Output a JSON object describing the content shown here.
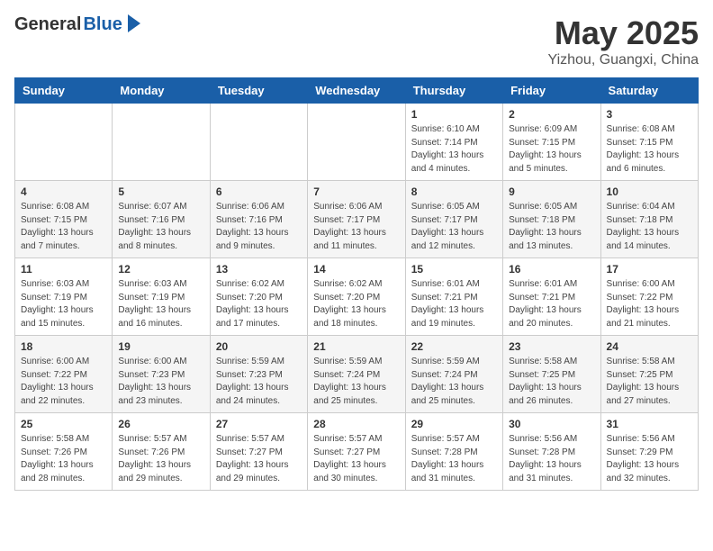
{
  "header": {
    "logo_general": "General",
    "logo_blue": "Blue",
    "month": "May 2025",
    "location": "Yizhou, Guangxi, China"
  },
  "weekdays": [
    "Sunday",
    "Monday",
    "Tuesday",
    "Wednesday",
    "Thursday",
    "Friday",
    "Saturday"
  ],
  "weeks": [
    [
      {
        "day": "",
        "info": ""
      },
      {
        "day": "",
        "info": ""
      },
      {
        "day": "",
        "info": ""
      },
      {
        "day": "",
        "info": ""
      },
      {
        "day": "1",
        "info": "Sunrise: 6:10 AM\nSunset: 7:14 PM\nDaylight: 13 hours\nand 4 minutes."
      },
      {
        "day": "2",
        "info": "Sunrise: 6:09 AM\nSunset: 7:15 PM\nDaylight: 13 hours\nand 5 minutes."
      },
      {
        "day": "3",
        "info": "Sunrise: 6:08 AM\nSunset: 7:15 PM\nDaylight: 13 hours\nand 6 minutes."
      }
    ],
    [
      {
        "day": "4",
        "info": "Sunrise: 6:08 AM\nSunset: 7:15 PM\nDaylight: 13 hours\nand 7 minutes."
      },
      {
        "day": "5",
        "info": "Sunrise: 6:07 AM\nSunset: 7:16 PM\nDaylight: 13 hours\nand 8 minutes."
      },
      {
        "day": "6",
        "info": "Sunrise: 6:06 AM\nSunset: 7:16 PM\nDaylight: 13 hours\nand 9 minutes."
      },
      {
        "day": "7",
        "info": "Sunrise: 6:06 AM\nSunset: 7:17 PM\nDaylight: 13 hours\nand 11 minutes."
      },
      {
        "day": "8",
        "info": "Sunrise: 6:05 AM\nSunset: 7:17 PM\nDaylight: 13 hours\nand 12 minutes."
      },
      {
        "day": "9",
        "info": "Sunrise: 6:05 AM\nSunset: 7:18 PM\nDaylight: 13 hours\nand 13 minutes."
      },
      {
        "day": "10",
        "info": "Sunrise: 6:04 AM\nSunset: 7:18 PM\nDaylight: 13 hours\nand 14 minutes."
      }
    ],
    [
      {
        "day": "11",
        "info": "Sunrise: 6:03 AM\nSunset: 7:19 PM\nDaylight: 13 hours\nand 15 minutes."
      },
      {
        "day": "12",
        "info": "Sunrise: 6:03 AM\nSunset: 7:19 PM\nDaylight: 13 hours\nand 16 minutes."
      },
      {
        "day": "13",
        "info": "Sunrise: 6:02 AM\nSunset: 7:20 PM\nDaylight: 13 hours\nand 17 minutes."
      },
      {
        "day": "14",
        "info": "Sunrise: 6:02 AM\nSunset: 7:20 PM\nDaylight: 13 hours\nand 18 minutes."
      },
      {
        "day": "15",
        "info": "Sunrise: 6:01 AM\nSunset: 7:21 PM\nDaylight: 13 hours\nand 19 minutes."
      },
      {
        "day": "16",
        "info": "Sunrise: 6:01 AM\nSunset: 7:21 PM\nDaylight: 13 hours\nand 20 minutes."
      },
      {
        "day": "17",
        "info": "Sunrise: 6:00 AM\nSunset: 7:22 PM\nDaylight: 13 hours\nand 21 minutes."
      }
    ],
    [
      {
        "day": "18",
        "info": "Sunrise: 6:00 AM\nSunset: 7:22 PM\nDaylight: 13 hours\nand 22 minutes."
      },
      {
        "day": "19",
        "info": "Sunrise: 6:00 AM\nSunset: 7:23 PM\nDaylight: 13 hours\nand 23 minutes."
      },
      {
        "day": "20",
        "info": "Sunrise: 5:59 AM\nSunset: 7:23 PM\nDaylight: 13 hours\nand 24 minutes."
      },
      {
        "day": "21",
        "info": "Sunrise: 5:59 AM\nSunset: 7:24 PM\nDaylight: 13 hours\nand 25 minutes."
      },
      {
        "day": "22",
        "info": "Sunrise: 5:59 AM\nSunset: 7:24 PM\nDaylight: 13 hours\nand 25 minutes."
      },
      {
        "day": "23",
        "info": "Sunrise: 5:58 AM\nSunset: 7:25 PM\nDaylight: 13 hours\nand 26 minutes."
      },
      {
        "day": "24",
        "info": "Sunrise: 5:58 AM\nSunset: 7:25 PM\nDaylight: 13 hours\nand 27 minutes."
      }
    ],
    [
      {
        "day": "25",
        "info": "Sunrise: 5:58 AM\nSunset: 7:26 PM\nDaylight: 13 hours\nand 28 minutes."
      },
      {
        "day": "26",
        "info": "Sunrise: 5:57 AM\nSunset: 7:26 PM\nDaylight: 13 hours\nand 29 minutes."
      },
      {
        "day": "27",
        "info": "Sunrise: 5:57 AM\nSunset: 7:27 PM\nDaylight: 13 hours\nand 29 minutes."
      },
      {
        "day": "28",
        "info": "Sunrise: 5:57 AM\nSunset: 7:27 PM\nDaylight: 13 hours\nand 30 minutes."
      },
      {
        "day": "29",
        "info": "Sunrise: 5:57 AM\nSunset: 7:28 PM\nDaylight: 13 hours\nand 31 minutes."
      },
      {
        "day": "30",
        "info": "Sunrise: 5:56 AM\nSunset: 7:28 PM\nDaylight: 13 hours\nand 31 minutes."
      },
      {
        "day": "31",
        "info": "Sunrise: 5:56 AM\nSunset: 7:29 PM\nDaylight: 13 hours\nand 32 minutes."
      }
    ]
  ]
}
